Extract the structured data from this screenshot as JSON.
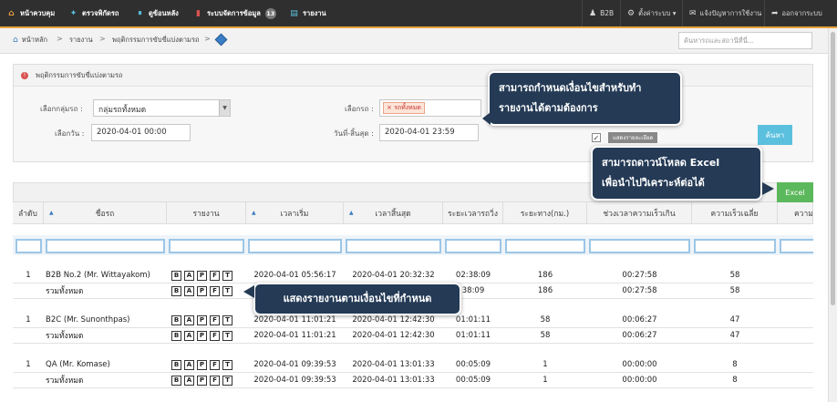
{
  "topnav": {
    "items": [
      {
        "icon": "home-icon",
        "label": "หน้าควบคุม"
      },
      {
        "icon": "check-icon",
        "label": "ตรวจพิกัดรถ"
      },
      {
        "icon": "history-icon",
        "label": "ดูข้อนหลัง"
      },
      {
        "icon": "chart-icon",
        "label": "ระบบจัดการข้อมูล",
        "badge": "13"
      },
      {
        "icon": "report-icon",
        "label": "รายงาน"
      }
    ],
    "right": [
      {
        "icon": "user-icon",
        "label": "B2B"
      },
      {
        "icon": "gear-icon",
        "label": "ตั้งค่าระบบ ▾"
      },
      {
        "icon": "mail-icon",
        "label": "แจ้งปัญหาการใช้งาน"
      },
      {
        "icon": "logout-icon",
        "label": "ออกจากระบบ"
      }
    ]
  },
  "breadcrumb": {
    "home": "หน้าหลัก",
    "level1": "รายงาน",
    "level2": "พฤติกรรมการขับขี่แบ่งตามรถ",
    "sep": ">"
  },
  "search": {
    "placeholder": "ค้นหารถและสถานีที่นี่..."
  },
  "filter": {
    "title": "พฤติกรรมการขับขี่แบ่งตามรถ",
    "group_label": "เลือกกลุ่มรถ :",
    "group_value": "กลุ่มรถทั้งหมด",
    "vehicle_label": "เลือกรถ :",
    "vehicle_tag": "× รถทั้งหมด",
    "date_label": "เลือกวัน :",
    "date_value": "2020-04-01 00:00",
    "end_label": "วันที่-สิ้นสุด :",
    "end_value": "2020-04-01 23:59",
    "detail_checkbox": "✓",
    "detail_label": "แสดงรายละเอียด",
    "search_button": "ค้นหา"
  },
  "excel_button": "Excel",
  "table": {
    "headers": [
      "ลำดับ",
      "ชื่อรถ",
      "รายงาน",
      "เวลาเริ่ม",
      "เวลาสิ้นสุด",
      "ระยะเวลารถวิ่ง",
      "ระยะทาง(กม.)",
      "ช่วงเวลาความเร็วเกิน",
      "ความเร็วเฉลี่ย",
      "ความ"
    ],
    "report_buttons": [
      "B",
      "A",
      "P",
      "F",
      "T"
    ],
    "rows": [
      {
        "no": "1",
        "name": "B2B No.2 (Mr. Wittayakom)",
        "start": "2020-04-01 05:56:17",
        "end": "2020-04-01 20:32:32",
        "duration": "02:38:09",
        "distance": "186",
        "overspeed": "00:27:58",
        "avg": "58"
      },
      {
        "no": "",
        "name": "รวมทั้งหมด",
        "start": "",
        "end": "",
        "duration": "38:09",
        "distance": "186",
        "overspeed": "00:27:58",
        "avg": "58"
      },
      {
        "no": "1",
        "name": "B2C (Mr. Sunonthpas)",
        "start": "2020-04-01 11:01:21",
        "end": "2020-04-01 12:42:30",
        "duration": "01:01:11",
        "distance": "58",
        "overspeed": "00:06:27",
        "avg": "47"
      },
      {
        "no": "",
        "name": "รวมทั้งหมด",
        "start": "2020-04-01 11:01:21",
        "end": "2020-04-01 12:42:30",
        "duration": "01:01:11",
        "distance": "58",
        "overspeed": "00:06:27",
        "avg": "47"
      },
      {
        "no": "1",
        "name": "QA (Mr. Komase)",
        "start": "2020-04-01 09:39:53",
        "end": "2020-04-01 13:01:33",
        "duration": "00:05:09",
        "distance": "1",
        "overspeed": "00:00:00",
        "avg": "8"
      },
      {
        "no": "",
        "name": "รวมทั้งหมด",
        "start": "2020-04-01 09:39:53",
        "end": "2020-04-01 13:01:33",
        "duration": "00:05:09",
        "distance": "1",
        "overspeed": "00:00:00",
        "avg": "8"
      }
    ]
  },
  "callouts": {
    "filter_line1": "สามารถกำหนดเงื่อนไขสำหรับทำ",
    "filter_line2": "รายงานได้ตามต้องการ",
    "excel_line1": "สามารถดาวน์โหลด Excel",
    "excel_line2": "เพื่อนำไปวิเคราะห์ต่อได้",
    "report": "แสดงรายงานตามเงื่อนไขที่กำหนด"
  },
  "colors": {
    "nav_bg": "#2f2f2f",
    "nav_accent": "#e8a13a",
    "callout_bg": "#243a55",
    "excel_green": "#5cb85c",
    "search_blue": "#5bc0de"
  }
}
